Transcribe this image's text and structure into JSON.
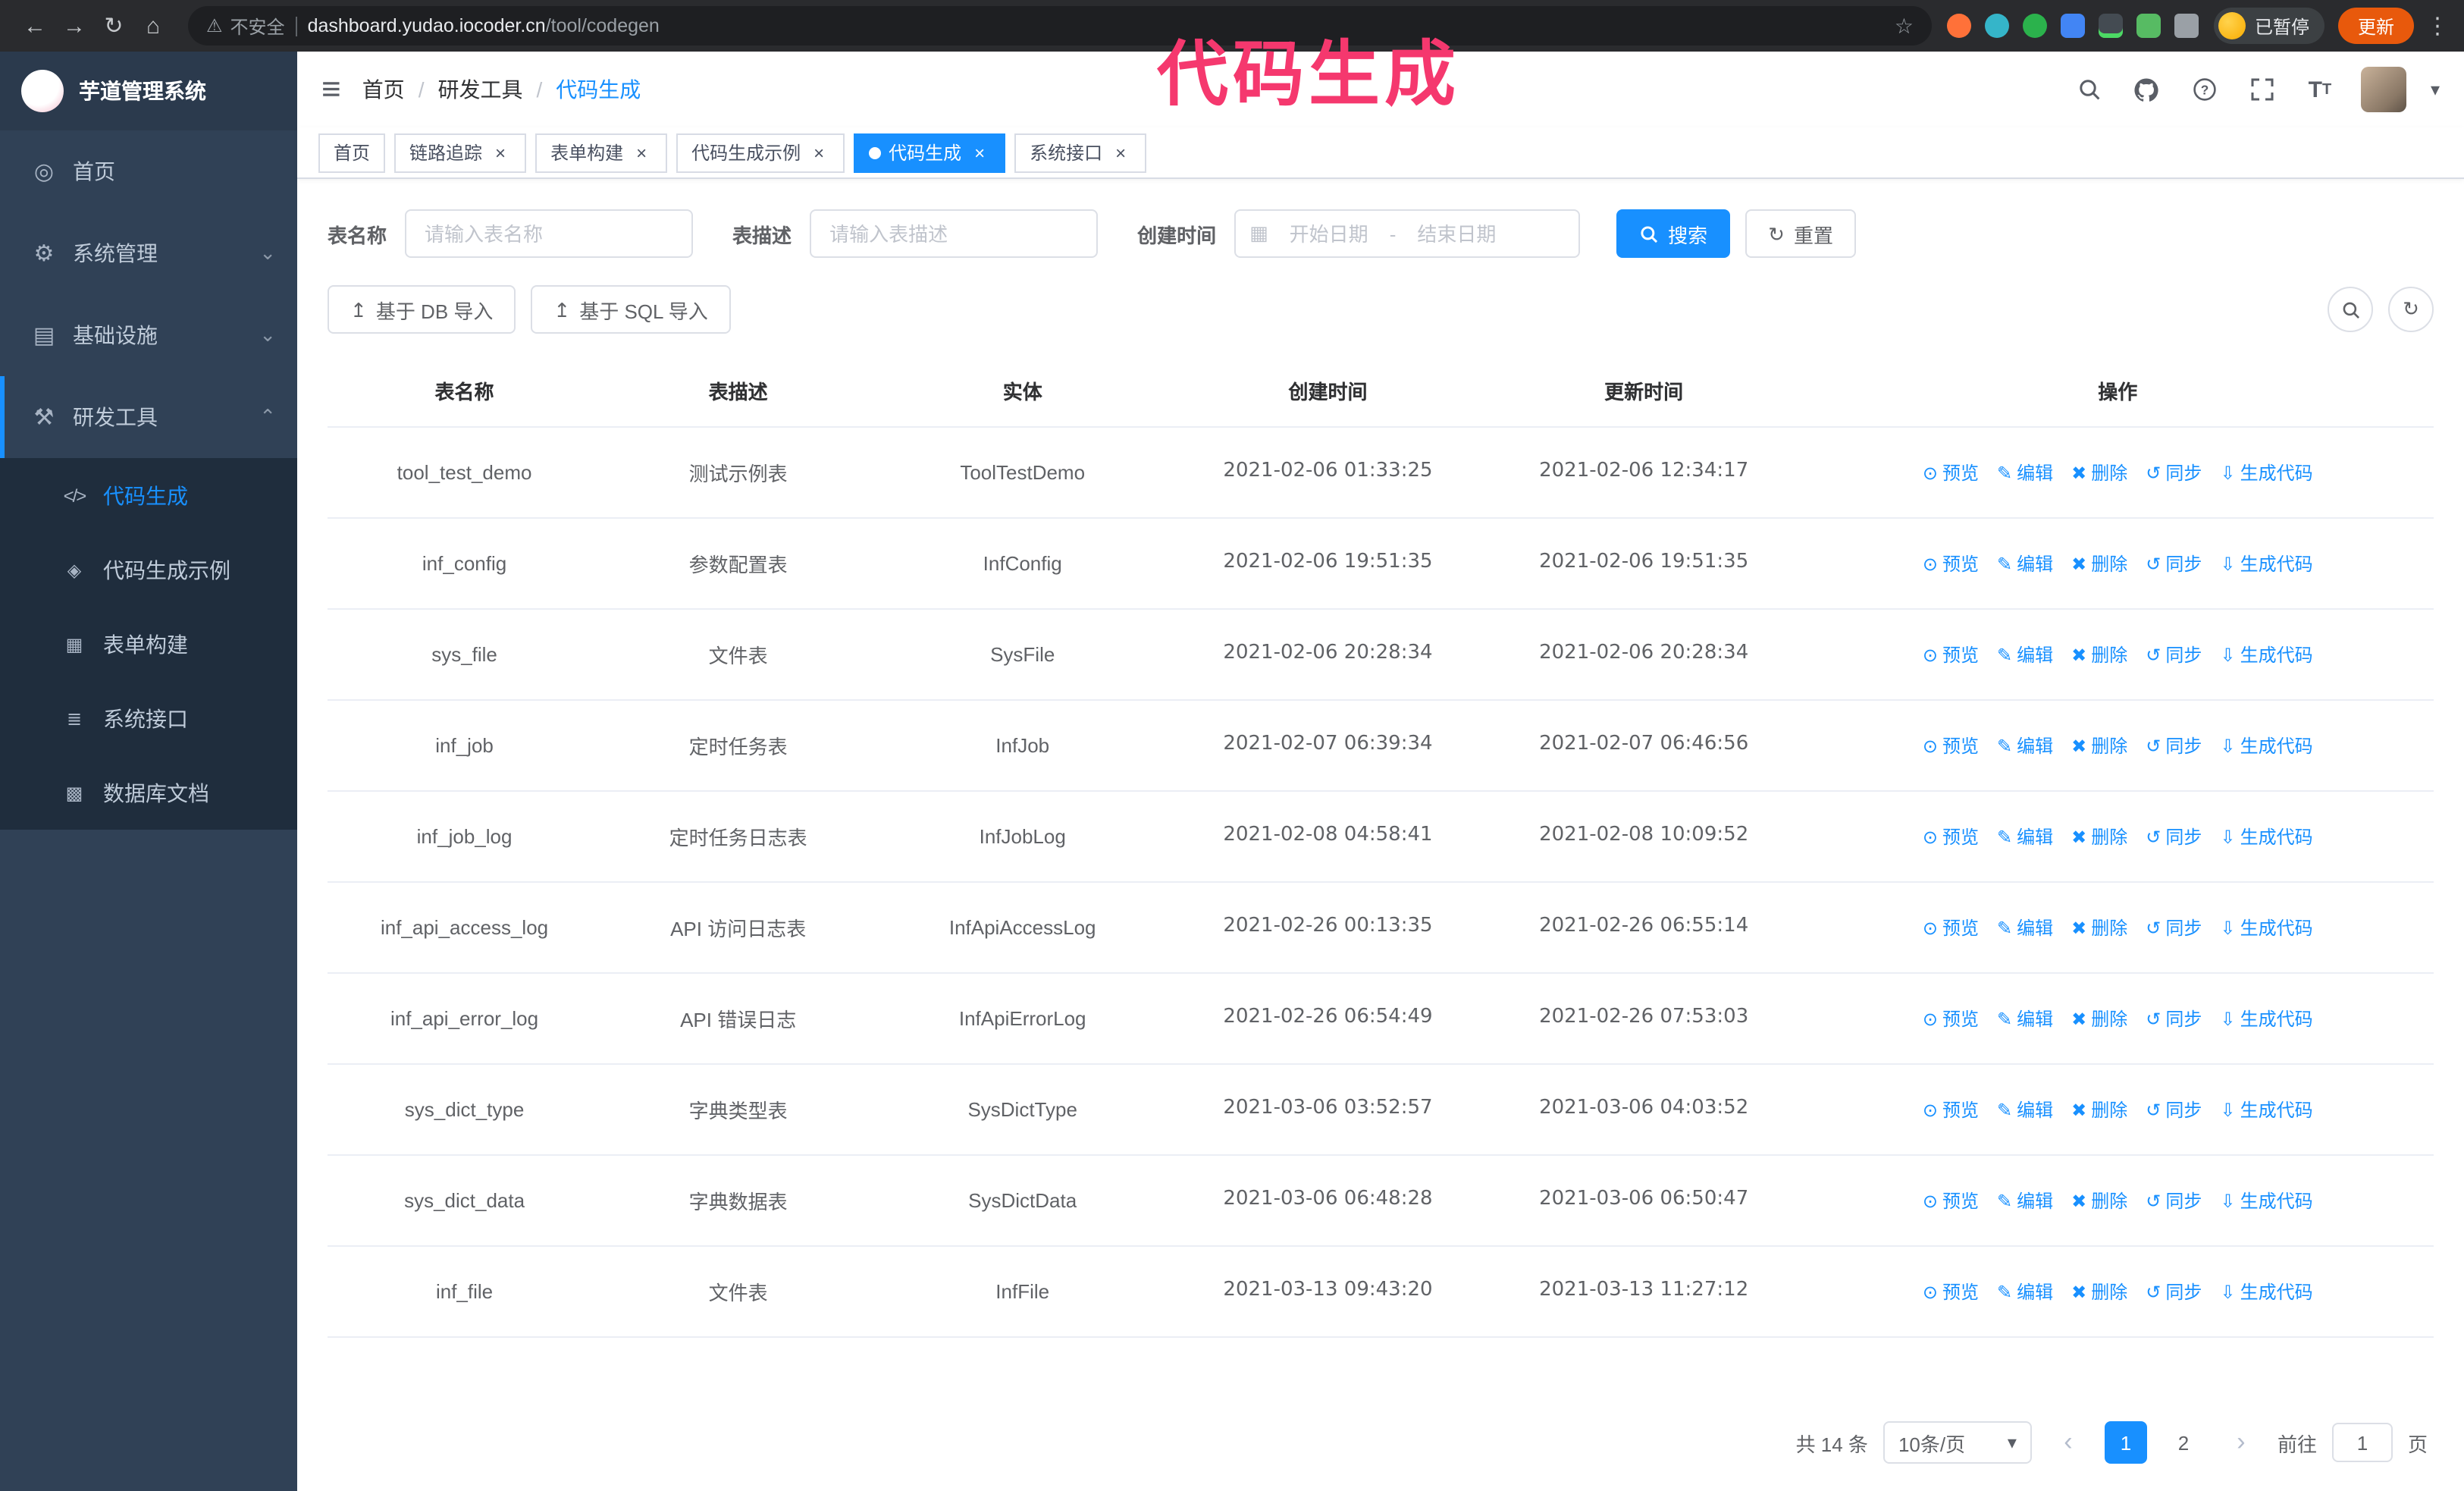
{
  "theme": {
    "accent": "#1890ff",
    "sidebar_bg": "#304156",
    "submenu_bg": "#1f2d3d",
    "chrome_bg": "#2a2b2e",
    "addressbar_bg": "#1e1f22",
    "update_bg": "#e8590c",
    "annotation": "#f5386e"
  },
  "annotation": {
    "text": "代码生成"
  },
  "browser": {
    "security_warning": "不安全",
    "url_domain": "dashboard.yudao.iocoder.cn",
    "url_path": "/tool/codegen",
    "paused_badge": "已暂停",
    "update_button": "更新"
  },
  "icons": {
    "back": "←",
    "forward": "→",
    "reload": "↻",
    "home": "⌂",
    "warning": "⚠",
    "star": "☆",
    "kebab": "⋮",
    "hamburger": "≡",
    "caret_down": "▾",
    "chevron_down": "⌄",
    "chevron_up": "⌃",
    "menu_home": "◎",
    "menu_system": "⚙",
    "menu_infra": "▤",
    "menu_tools": "⚒",
    "menu_codegen": "</>",
    "menu_example": "◈",
    "menu_form": "▦",
    "menu_api": "≣",
    "menu_dbdoc": "▩",
    "calendar": "▦",
    "upload": "↥",
    "refresh": "↻",
    "question": "?",
    "font_size": "T",
    "eye": "⊙",
    "edit": "✎",
    "trash": "✖",
    "sync": "↺",
    "download": "⇩",
    "close": "×",
    "arrow_left": "‹",
    "arrow_right": "›"
  },
  "sidebar": {
    "logo_title": "芋道管理系统",
    "items": [
      {
        "label": "首页"
      },
      {
        "label": "系统管理"
      },
      {
        "label": "基础设施"
      },
      {
        "label": "研发工具"
      }
    ],
    "submenu": [
      {
        "label": "代码生成",
        "active": true
      },
      {
        "label": "代码生成示例"
      },
      {
        "label": "表单构建"
      },
      {
        "label": "系统接口"
      },
      {
        "label": "数据库文档"
      }
    ]
  },
  "header": {
    "breadcrumb": [
      "首页",
      "研发工具",
      "代码生成"
    ],
    "separator": "/"
  },
  "tabs": [
    {
      "label": "首页",
      "closable": false,
      "active": false
    },
    {
      "label": "链路追踪",
      "closable": true,
      "active": false
    },
    {
      "label": "表单构建",
      "closable": true,
      "active": false
    },
    {
      "label": "代码生成示例",
      "closable": true,
      "active": false
    },
    {
      "label": "代码生成",
      "closable": true,
      "active": true
    },
    {
      "label": "系统接口",
      "closable": true,
      "active": false
    }
  ],
  "filters": {
    "table_name_label": "表名称",
    "table_name_placeholder": "请输入表名称",
    "table_desc_label": "表描述",
    "table_desc_placeholder": "请输入表描述",
    "create_time_label": "创建时间",
    "date_start_placeholder": "开始日期",
    "date_separator": "-",
    "date_end_placeholder": "结束日期",
    "search_button": "搜索",
    "reset_button": "重置"
  },
  "toolbar": {
    "import_db_button": "基于 DB 导入",
    "import_sql_button": "基于 SQL 导入"
  },
  "table": {
    "columns": [
      "表名称",
      "表描述",
      "实体",
      "创建时间",
      "更新时间",
      "操作"
    ],
    "op_labels": [
      "预览",
      "编辑",
      "删除",
      "同步",
      "生成代码"
    ],
    "rows": [
      [
        "tool_test_demo",
        "测试示例表",
        "ToolTestDemo",
        "2021-02-06 01:33:25",
        "2021-02-06 12:34:17"
      ],
      [
        "inf_config",
        "参数配置表",
        "InfConfig",
        "2021-02-06 19:51:35",
        "2021-02-06 19:51:35"
      ],
      [
        "sys_file",
        "文件表",
        "SysFile",
        "2021-02-06 20:28:34",
        "2021-02-06 20:28:34"
      ],
      [
        "inf_job",
        "定时任务表",
        "InfJob",
        "2021-02-07 06:39:34",
        "2021-02-07 06:46:56"
      ],
      [
        "inf_job_log",
        "定时任务日志表",
        "InfJobLog",
        "2021-02-08 04:58:41",
        "2021-02-08 10:09:52"
      ],
      [
        "inf_api_access_log",
        "API 访问日志表",
        "InfApiAccessLog",
        "2021-02-26 00:13:35",
        "2021-02-26 06:55:14"
      ],
      [
        "inf_api_error_log",
        "API 错误日志",
        "InfApiErrorLog",
        "2021-02-26 06:54:49",
        "2021-02-26 07:53:03"
      ],
      [
        "sys_dict_type",
        "字典类型表",
        "SysDictType",
        "2021-03-06 03:52:57",
        "2021-03-06 04:03:52"
      ],
      [
        "sys_dict_data",
        "字典数据表",
        "SysDictData",
        "2021-03-06 06:48:28",
        "2021-03-06 06:50:47"
      ],
      [
        "inf_file",
        "文件表",
        "InfFile",
        "2021-03-13 09:43:20",
        "2021-03-13 11:27:12"
      ]
    ]
  },
  "pagination": {
    "total_text": "共 14 条",
    "page_size": "10条/页",
    "pages": [
      "1",
      "2"
    ],
    "active_page": "1",
    "goto_label": "前往",
    "goto_value": "1",
    "goto_suffix": "页"
  }
}
